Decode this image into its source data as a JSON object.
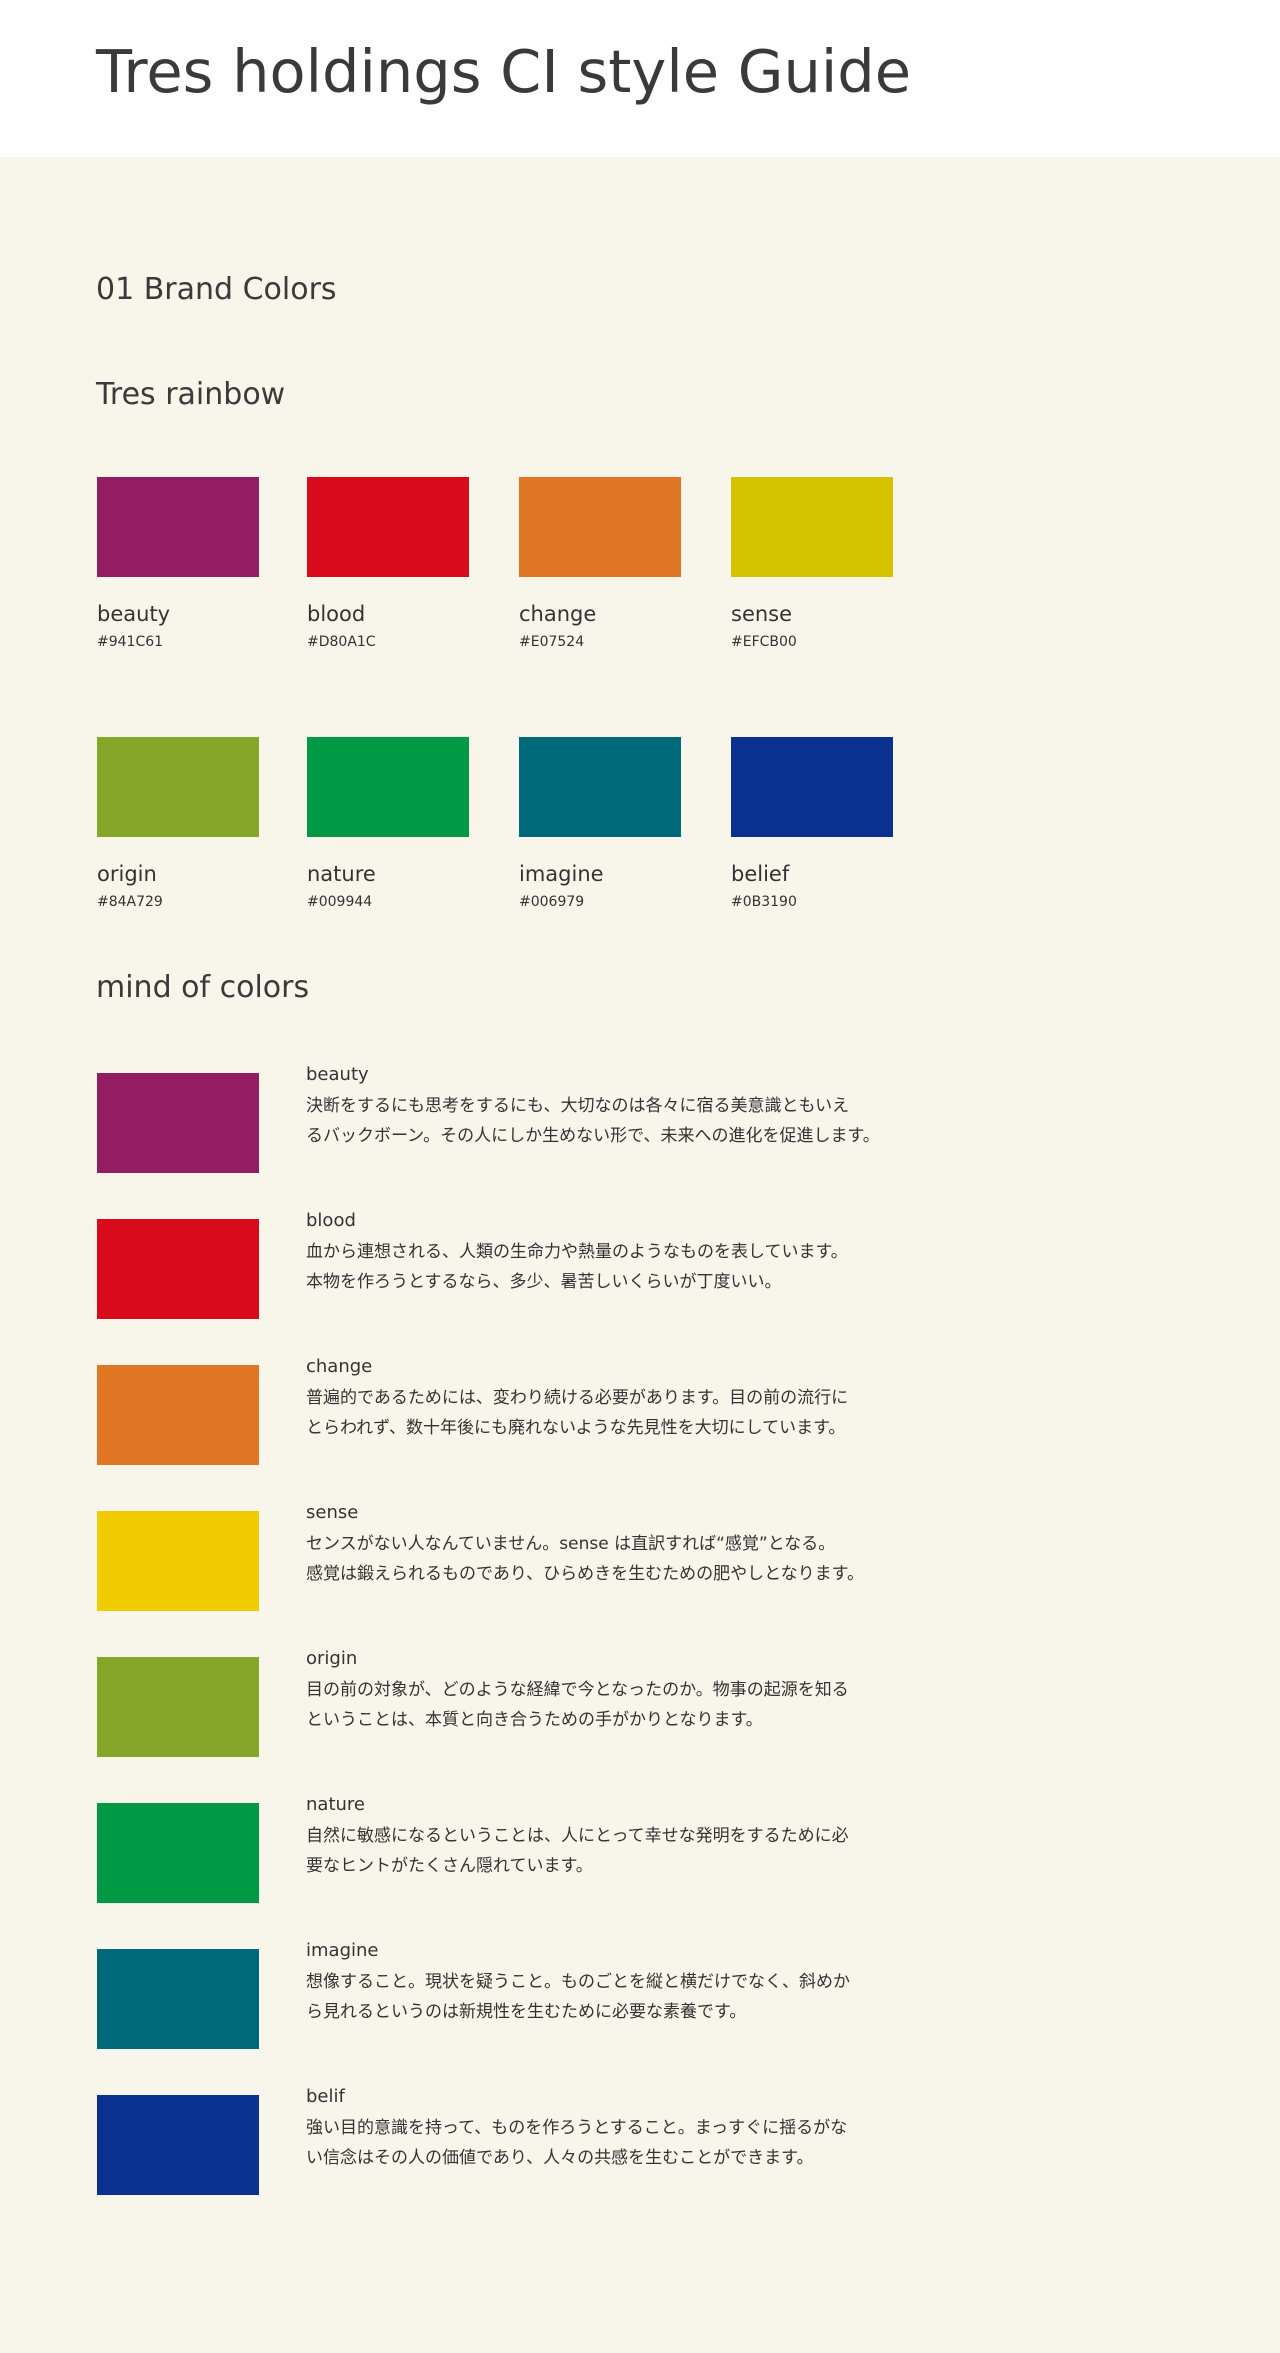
{
  "header": {
    "title": "Tres holdings CI style Guide"
  },
  "section": {
    "title": "01 Brand Colors"
  },
  "rainbow": {
    "title": "Tres rainbow",
    "colors": [
      {
        "name": "beauty",
        "hex_label": "#941C61",
        "color": "#941C61"
      },
      {
        "name": "blood",
        "hex_label": "#D80A1C",
        "color": "#D80A1C"
      },
      {
        "name": "change",
        "hex_label": "#E07524",
        "color": "#E07524"
      },
      {
        "name": "sense",
        "hex_label": "#EFCB00",
        "color": "#D6C300"
      },
      {
        "name": "origin",
        "hex_label": "#84A729",
        "color": "#84A729"
      },
      {
        "name": "nature",
        "hex_label": "#009944",
        "color": "#009944"
      },
      {
        "name": "imagine",
        "hex_label": "#006979",
        "color": "#006979"
      },
      {
        "name": "belief",
        "hex_label": "#0B3190",
        "color": "#0B3190"
      }
    ]
  },
  "mind": {
    "title": "mind of colors",
    "items": [
      {
        "name": "beauty",
        "color": "#941C61",
        "lines": [
          "決断をするにも思考をするにも、大切なのは各々に宿る美意識ともいえ",
          "るバックボーン。その人にしか生めない形で、未来への進化を促進します。"
        ]
      },
      {
        "name": "blood",
        "color": "#D80A1C",
        "lines": [
          "血から連想される、人類の生命力や熱量のようなものを表しています。",
          "本物を作ろうとするなら、多少、暑苦しいくらいが丁度いい。"
        ]
      },
      {
        "name": "change",
        "color": "#E07524",
        "lines": [
          "普遍的であるためには、変わり続ける必要があります。目の前の流行に",
          "とらわれず、数十年後にも廃れないような先見性を大切にしています。"
        ]
      },
      {
        "name": "sense",
        "color": "#EFCB00",
        "lines": [
          "センスがない人なんていません。sense は直訳すれば“感覚”となる。",
          "感覚は鍛えられるものであり、ひらめきを生むための肥やしとなります。"
        ]
      },
      {
        "name": "origin",
        "color": "#84A729",
        "lines": [
          "目の前の対象が、どのような経緯で今となったのか。物事の起源を知る",
          "ということは、本質と向き合うための手がかりとなります。"
        ]
      },
      {
        "name": "nature",
        "color": "#009944",
        "lines": [
          "自然に敏感になるということは、人にとって幸せな発明をするために必",
          "要なヒントがたくさん隠れています。"
        ]
      },
      {
        "name": "imagine",
        "color": "#006979",
        "lines": [
          "想像すること。現状を疑うこと。ものごとを縦と横だけでなく、斜めか",
          "ら見れるというのは新規性を生むために必要な素養です。"
        ]
      },
      {
        "name": "belif",
        "color": "#0B3190",
        "lines": [
          "強い目的意識を持って、ものを作ろうとすること。まっすぐに揺るがな",
          "い信念はその人の価値であり、人々の共感を生むことができます。"
        ]
      }
    ]
  }
}
